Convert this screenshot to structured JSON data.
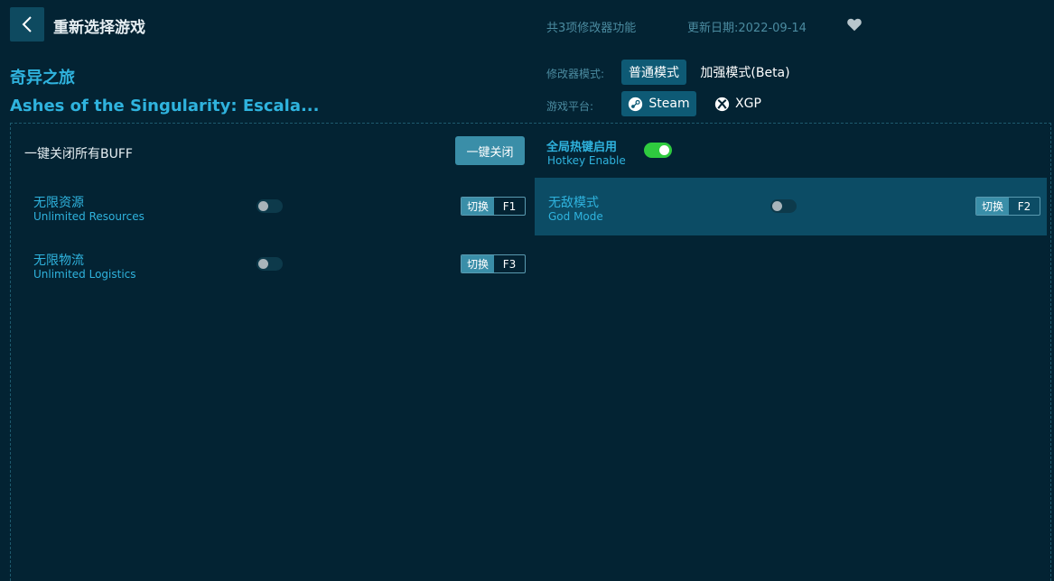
{
  "header": {
    "title": "重新选择游戏",
    "feature_count": "共3项修改器功能",
    "update_date": "更新日期:2022-09-14"
  },
  "game": {
    "name_cn": "奇异之旅",
    "name_en": "Ashes of the Singularity: Escala..."
  },
  "mode": {
    "label": "修改器模式:",
    "options": [
      "普通模式",
      "加强模式(Beta)"
    ],
    "selected": "普通模式"
  },
  "platform": {
    "label": "游戏平台:",
    "options": [
      "Steam",
      "XGP"
    ],
    "selected": "Steam"
  },
  "controls": {
    "buff_label": "一键关闭所有BUFF",
    "close_all_label": "一键关闭",
    "hotkey_cn": "全局热键启用",
    "hotkey_en": "Hotkey Enable",
    "hotkey_enabled": true
  },
  "options": [
    {
      "name_cn": "无限资源",
      "name_en": "Unlimited Resources",
      "enabled": false,
      "tag": "切换",
      "key": "F1"
    },
    {
      "name_cn": "无敌模式",
      "name_en": "God Mode",
      "enabled": false,
      "tag": "切换",
      "key": "F2"
    },
    {
      "name_cn": "无限物流",
      "name_en": "Unlimited Logistics",
      "enabled": false,
      "tag": "切换",
      "key": "F3"
    }
  ],
  "colors": {
    "background": "#032333",
    "accent": "#2fb3de",
    "toggle_on": "#2fcb3f",
    "highlight_row": "#0c4c65"
  }
}
